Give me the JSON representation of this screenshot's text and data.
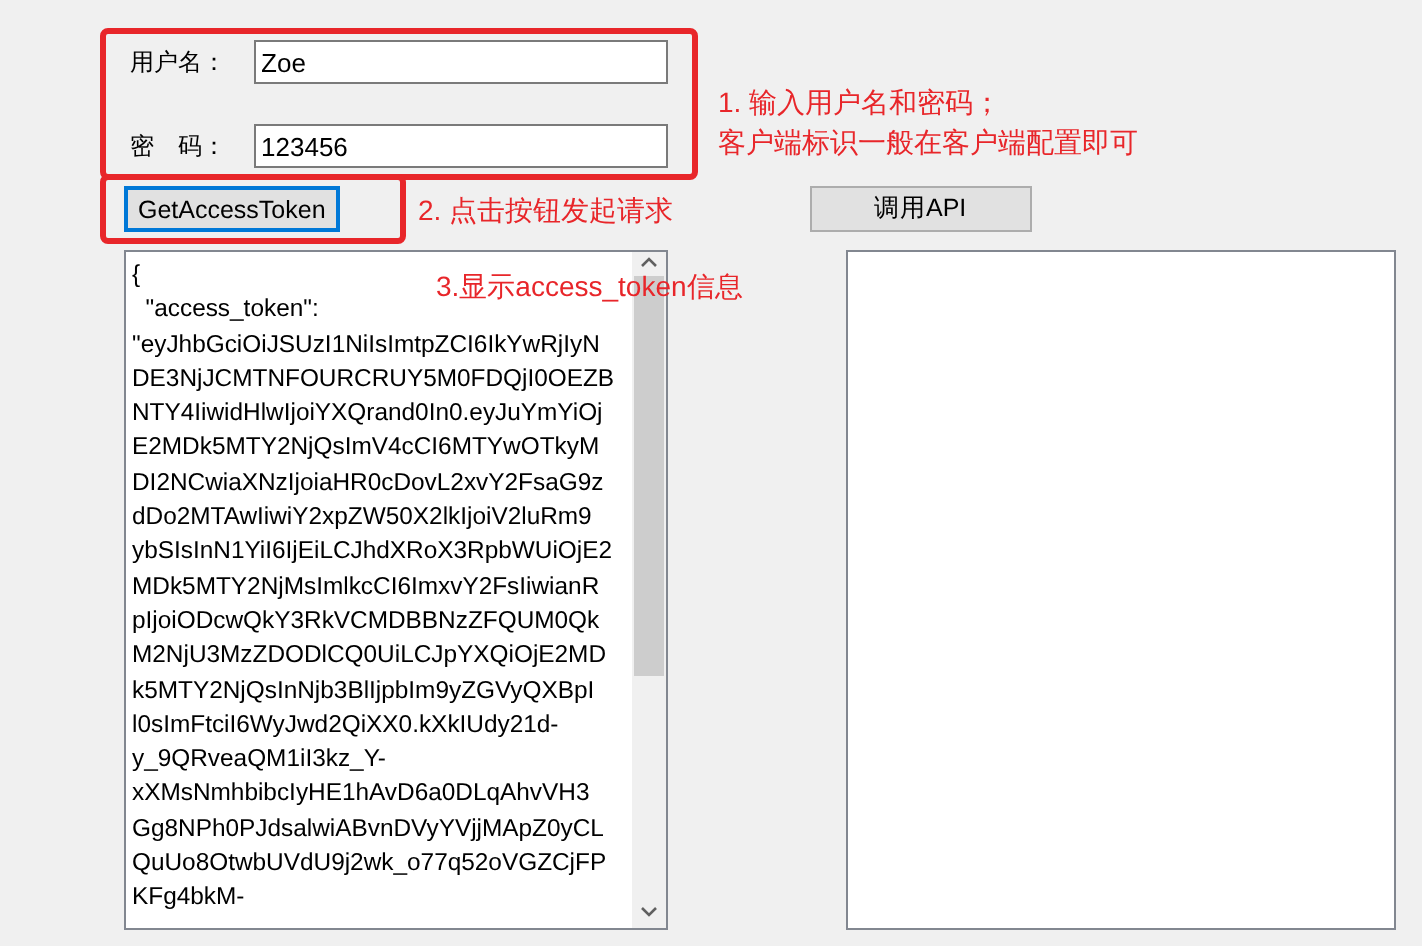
{
  "login_form": {
    "fields": [
      {
        "label": "用户名：",
        "value": "Zoe"
      },
      {
        "label": "密　码：",
        "value": "123456"
      }
    ]
  },
  "annotations": [
    [
      "1. 输入用户名和密码；",
      "客户端标识一般在客户端配置即可"
    ],
    [
      "2. 点击按钮发起请求"
    ],
    [
      "3.显示access_token信息"
    ]
  ],
  "get_token_button": {
    "label": "GetAccessToken",
    "focused": true
  },
  "call_api_button": {
    "label": "调用API"
  },
  "token_output": {
    "lines": [
      "{",
      "  \"access_token\":",
      "\"eyJhbGciOiJSUzI1NiIsImtpZCI6IkYwRjIyN",
      "DE3NjJCMTNFOURCRUY5M0FDQjI0OEZB",
      "NTY4IiwidHlwIjoiYXQrand0In0.eyJuYmYiOj",
      "E2MDk5MTY2NjQsImV4cCI6MTYwOTkyM",
      "DI2NCwiaXNzIjoiaHR0cDovL2xvY2FsaG9z",
      "dDo2MTAwIiwiY2xpZW50X2lkIjoiV2luRm9",
      "ybSIsInN1YiI6IjEiLCJhdXRoX3RpbWUiOjE2",
      "MDk5MTY2NjMsImlkcCI6ImxvY2FsIiwianR",
      "pIjoiODcwQkY3RkVCMDBBNzZFQUM0Qk",
      "M2NjU3MzZDODlCQ0UiLCJpYXQiOjE2MD",
      "k5MTY2NjQsInNjb3BlIjpbIm9yZGVyQXBpI",
      "l0sImFtciI6WyJwd2QiXX0.kXkIUdy21d-",
      "y_9QRveaQM1iI3kz_Y-",
      "xXMsNmhbibcIyHE1hAvD6a0DLqAhvVH3",
      "Gg8NPh0PJdsalwiABvnDVyYVjjMApZ0yCL",
      "QuUo8OtwbUVdU9j2wk_o77q52oVGZCjFP",
      "KFg4bkM-"
    ]
  }
}
